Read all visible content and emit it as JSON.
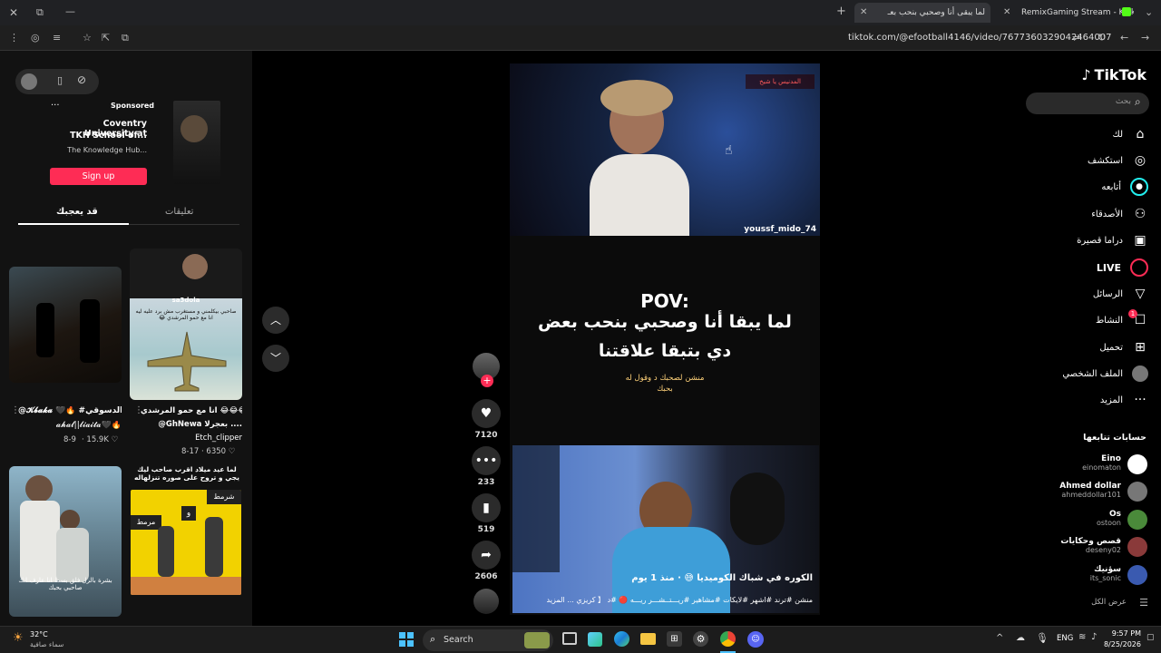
{
  "browser": {
    "tabs": [
      {
        "title": "لما يبقى أنا وصحبي بنحب بعـ"
      },
      {
        "title": "RemixGaming Stream - Kick Da"
      }
    ],
    "url": "tiktok.com/@efootball4146/video/7677360329042464007"
  },
  "ad": {
    "sponsored_label": "Sponsored",
    "title_line1": "Coventry University at",
    "title_line2": "TKH School of...",
    "source": "The Knowledge Hub...",
    "signup_label": "Sign up"
  },
  "left_tabs": {
    "active": "قد يعجبك",
    "other": "تعليقات"
  },
  "recommendations": [
    {
      "title": "@𝓚𝓫𝓪𝓴𝓪 🖤🔥 #الاسطوره #رفاعي_الدسوقي...",
      "author": "𝓪𝓱𝓪𝓵||𝓵𝓲𝓪𝓲𝓽𝓪🖤🔥",
      "date": "8-9",
      "likes": "15.9K"
    },
    {
      "title": "انا مع حمو المرشدي 😂😂😂",
      "sub": "@GhNewa بعجرلا ....",
      "author": "Etch_clipper",
      "date": "8-17",
      "likes": "6350",
      "thumb_text": "sa3dola",
      "thumb_caption": "صاحبي بيكلمني و مستغرب مش برد عليه ليه انا مع حمو المرشدي 😂"
    },
    {
      "thumb_text": "بشرة بالزل فلق بسط انا عارف انك صاحبي بحبك"
    },
    {
      "title": "لما عيد ميلاد اقرب صاحب ليك يجي و تروح على صوره تنزلهاله",
      "panel_left": "مرمط",
      "panel_right": "شرمط",
      "panel_mid": "و"
    }
  ],
  "video": {
    "overlay_tag": "المدنيس يا شيخ",
    "streamer_top": "youssf_mido_74",
    "pov": "POV:",
    "caption_line1": "لما يبقا أنا وصحبي بنحب بعض",
    "caption_line2": "دي بتبقا علاقتنا",
    "hint_line1": "منشن لصحبك د وقول له",
    "hint_line2": "بحبك",
    "bottom_title": "الكوره في شباك الكوميديا 😅 · منذ 1 يوم",
    "bottom_tags": "منشن #ترند #اشهر #لايكات #مشاهير #ريـــتــشـــر ريـــه 🔴 #د 【 كريزي ... المزيد"
  },
  "actions": {
    "likes": "7120",
    "comments": "233",
    "saves": "519",
    "shares": "2606"
  },
  "nav": {
    "logo": "TikTok",
    "search_placeholder": "بحث",
    "items": [
      {
        "label": "لك",
        "icon": "home-icon"
      },
      {
        "label": "استكشف",
        "icon": "compass-icon"
      },
      {
        "label": "أتابعه",
        "icon": "following-icon"
      },
      {
        "label": "الأصدقاء",
        "icon": "friends-icon"
      },
      {
        "label": "دراما قصيرة",
        "icon": "drama-icon"
      },
      {
        "label": "LIVE",
        "icon": "live-icon"
      },
      {
        "label": "الرسائل",
        "icon": "send-icon"
      },
      {
        "label": "النشاط",
        "icon": "activity-icon",
        "badge": "1"
      },
      {
        "label": "تحميل",
        "icon": "upload-icon"
      },
      {
        "label": "الملف الشخصي",
        "icon": "profile-icon"
      },
      {
        "label": "المزيد",
        "icon": "more-icon"
      }
    ],
    "following_header": "حسابات تتابعها",
    "accounts": [
      {
        "name": "Eino",
        "handle": "einomaton"
      },
      {
        "name": "Ahmed dollar",
        "handle": "ahmeddollar101"
      },
      {
        "name": "Os",
        "handle": "ostoon"
      },
      {
        "name": "قصص وحكايات",
        "handle": "deseny02"
      },
      {
        "name": "سؤنيك",
        "handle": "its_sonic"
      }
    ],
    "show_all": "عرض الكل"
  },
  "taskbar": {
    "weather_temp": "32°C",
    "weather_desc": "سماء صافية",
    "search_label": "Search",
    "lang": "ENG",
    "time": "9:57 PM",
    "date": "8/25/2026"
  }
}
